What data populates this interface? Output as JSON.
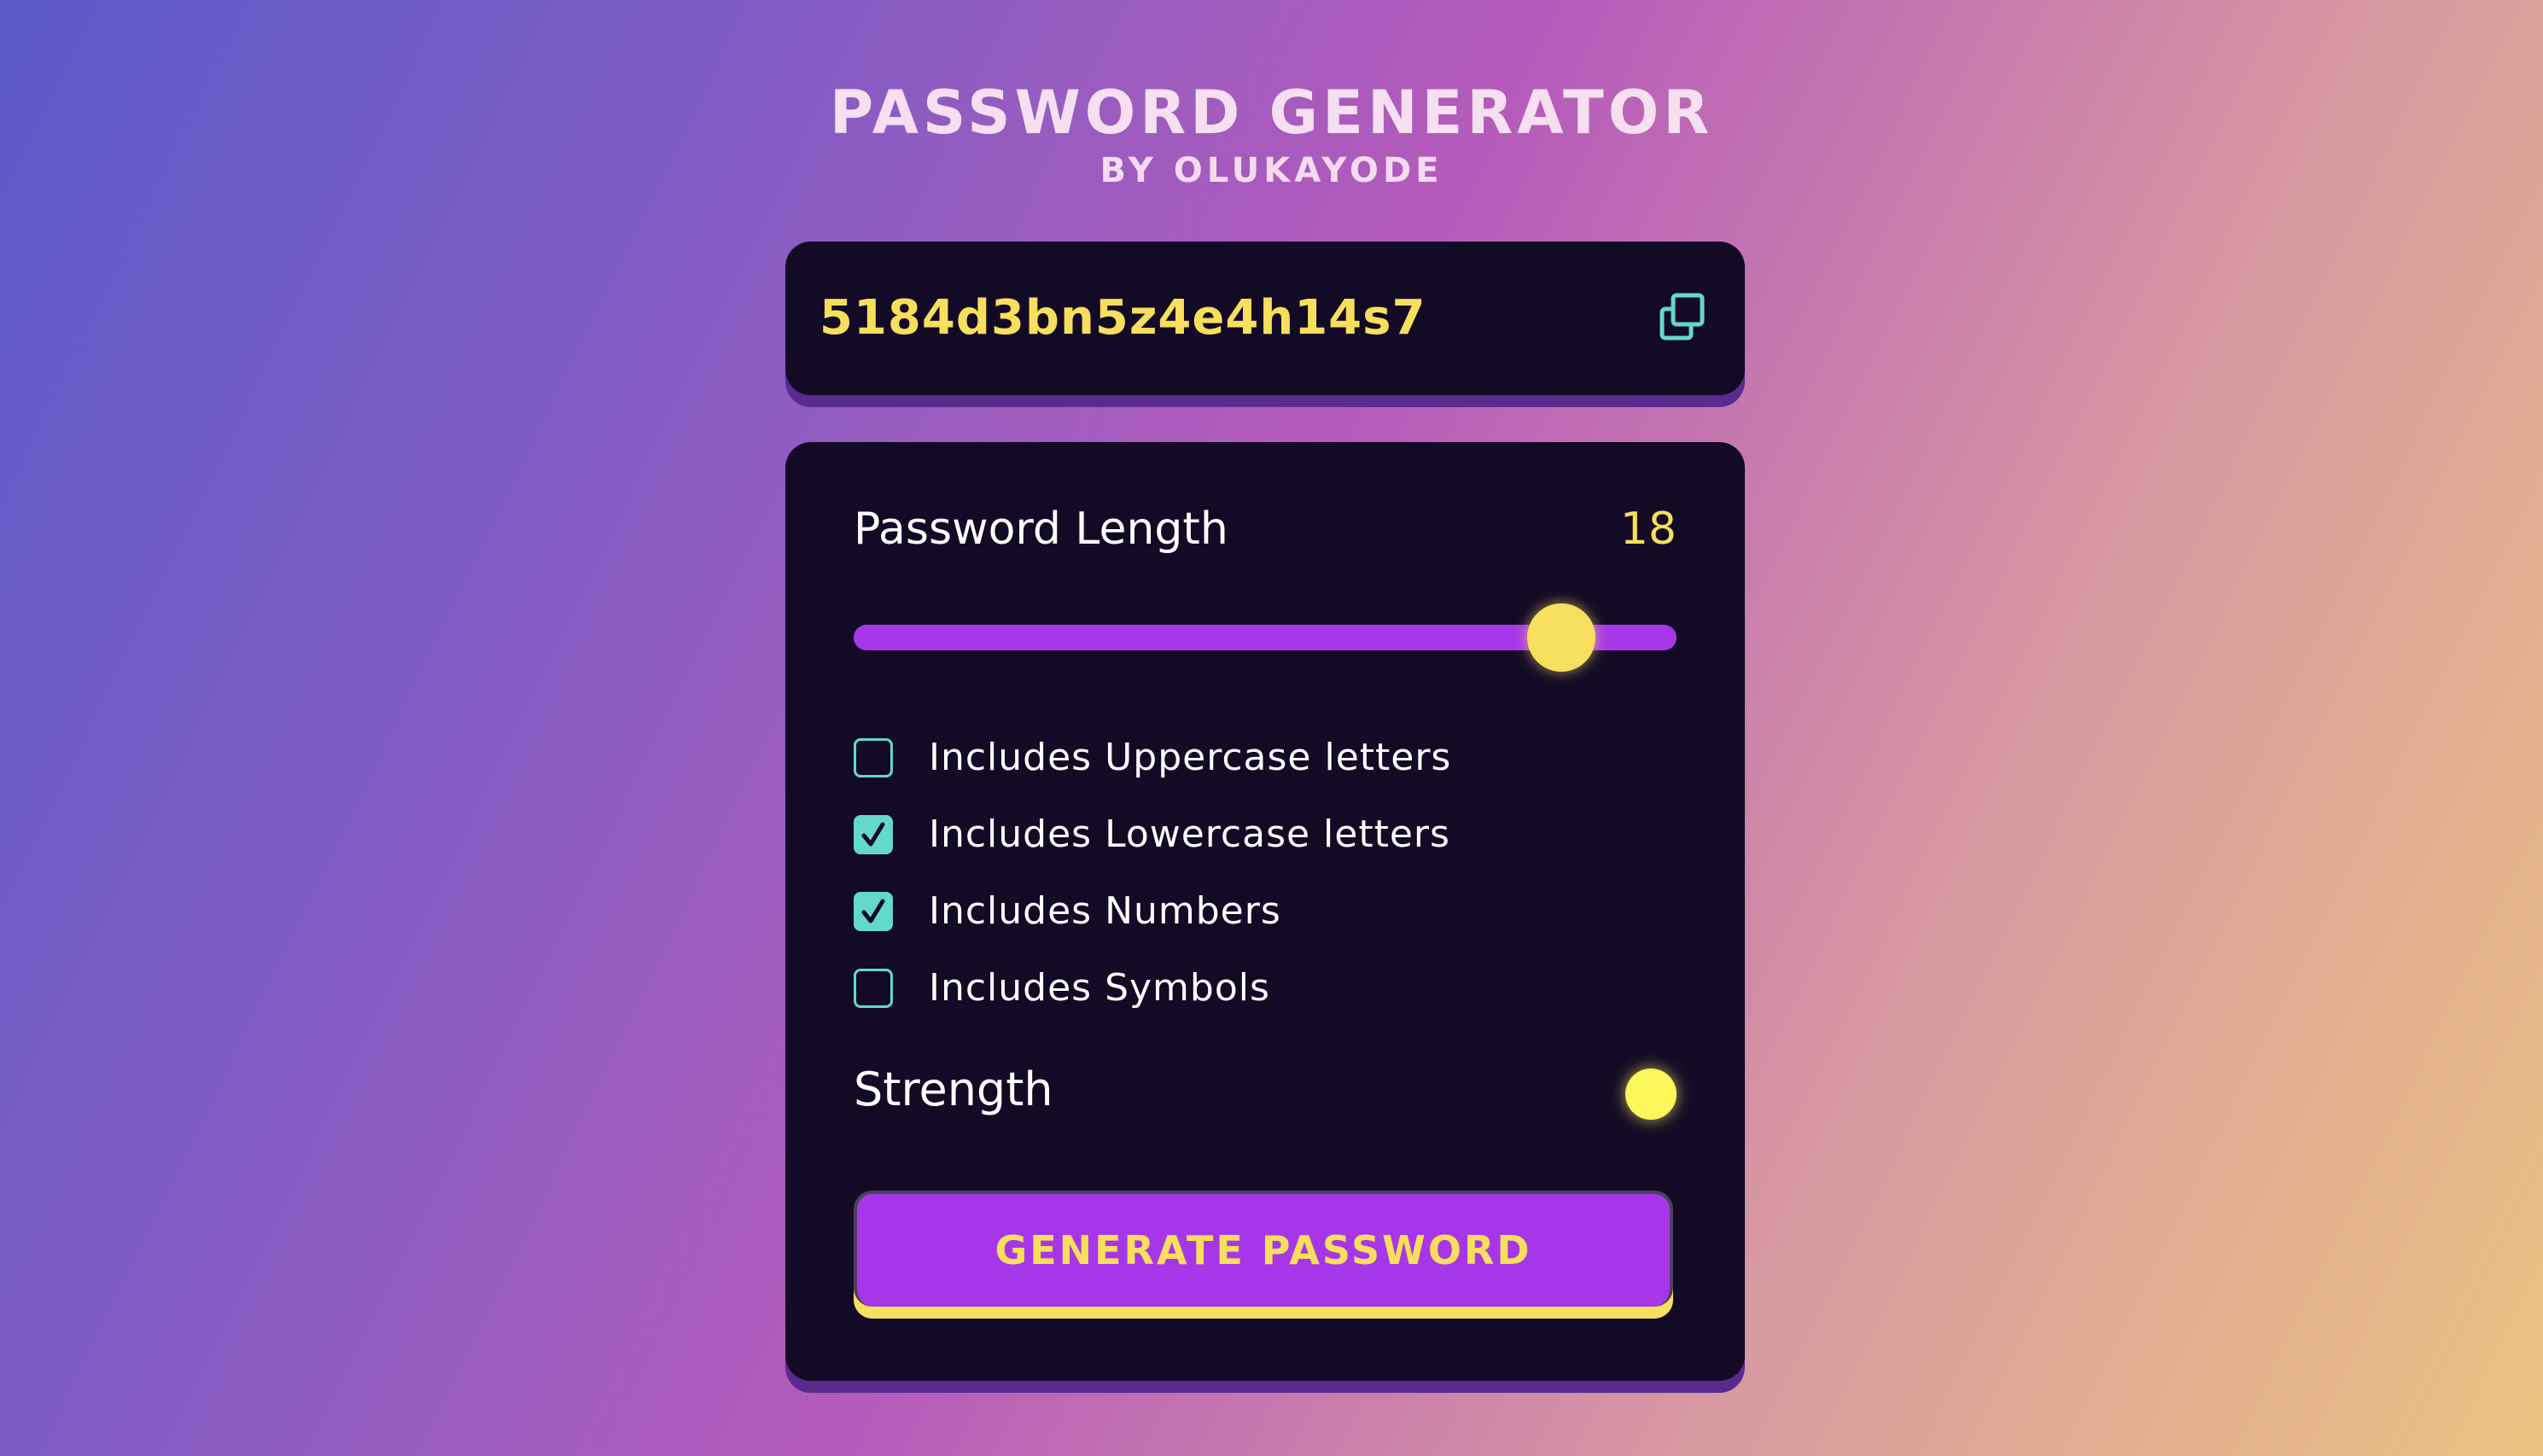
{
  "header": {
    "title": "PASSWORD GENERATOR",
    "subtitle": "BY OLUKAYODE"
  },
  "password": {
    "value": "5184d3bn5z4e4h14s7",
    "copy_icon": "copy-icon"
  },
  "length": {
    "label": "Password Length",
    "value": "18",
    "slider_fraction": 0.86
  },
  "options": [
    {
      "label": "Includes Uppercase letters",
      "checked": false
    },
    {
      "label": "Includes Lowercase letters",
      "checked": true
    },
    {
      "label": "Includes Numbers",
      "checked": true
    },
    {
      "label": "Includes Symbols",
      "checked": false
    }
  ],
  "strength": {
    "label": "Strength",
    "indicator_color": "#fbf65a"
  },
  "generate_button": {
    "label": "GENERATE PASSWORD"
  },
  "colors": {
    "accent_purple": "#a637e8",
    "accent_yellow": "#f7de5c",
    "checkbox_teal": "#63d8cb",
    "card_background": "#130a26"
  }
}
